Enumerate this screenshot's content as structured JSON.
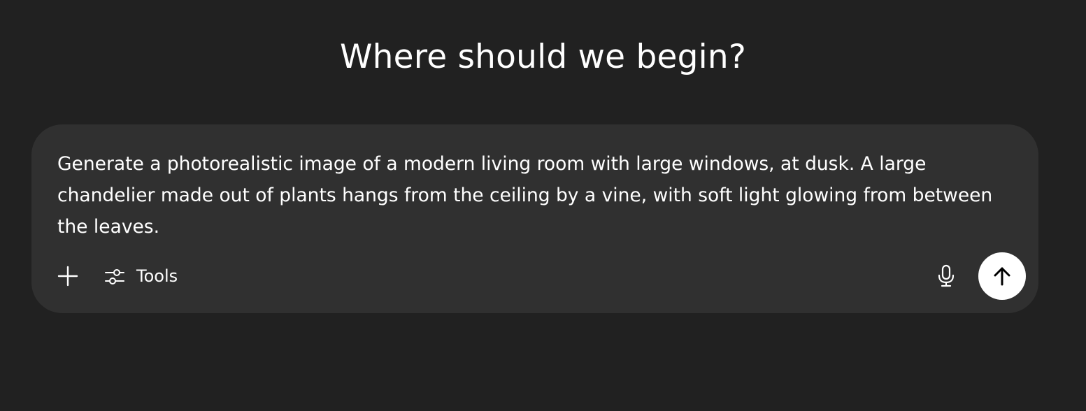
{
  "heading": "Where should we begin?",
  "composer": {
    "prompt_text": "Generate a photorealistic image of a modern living room with large windows, at dusk. A large chandelier made out of plants hangs from the ceiling by a vine, with soft light glowing from between the leaves.",
    "toolbar": {
      "add_icon": "plus-icon",
      "tools_icon": "sliders-icon",
      "tools_label": "Tools",
      "mic_icon": "microphone-icon",
      "send_icon": "arrow-up-icon"
    }
  },
  "colors": {
    "background": "#212121",
    "composer_background": "#303030",
    "text": "#ffffff",
    "send_button": "#ffffff",
    "send_icon": "#000000"
  }
}
